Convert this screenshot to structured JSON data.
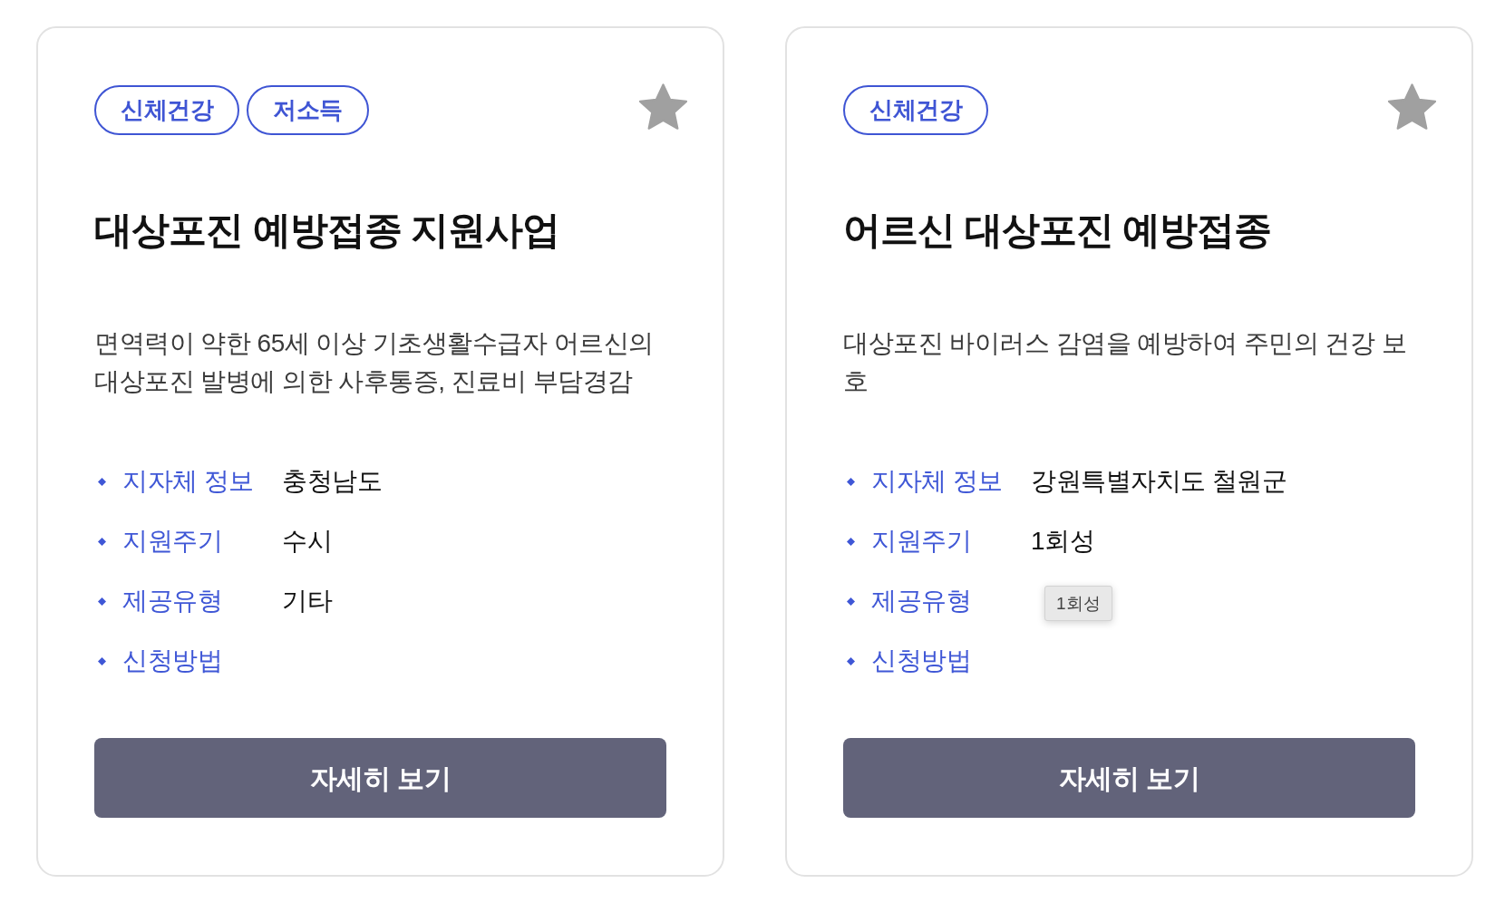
{
  "cards": [
    {
      "tags": [
        "신체건강",
        "저소득"
      ],
      "favorite": false,
      "title": "대상포진 예방접종 지원사업",
      "description": "면역력이 약한 65세 이상 기초생활수급자 어르신의 대상포진 발병에 의한 사후통증, 진료비 부담경감",
      "info": [
        {
          "label": "지자체 정보",
          "value": "충청남도"
        },
        {
          "label": "지원주기",
          "value": "수시"
        },
        {
          "label": "제공유형",
          "value": "기타"
        },
        {
          "label": "신청방법"
        }
      ],
      "button": "자세히 보기"
    },
    {
      "tags": [
        "신체건강"
      ],
      "favorite": false,
      "title": "어르신 대상포진 예방접종",
      "description": "대상포진 바이러스 감염을 예방하여 주민의 건강 보호",
      "info": [
        {
          "label": "지자체 정보",
          "value": "강원특별자치도 철원군"
        },
        {
          "label": "지원주기",
          "value": "1회성"
        },
        {
          "label": "제공유형",
          "tooltip": "1회성"
        },
        {
          "label": "신청방법"
        }
      ],
      "button": "자세히 보기"
    }
  ]
}
